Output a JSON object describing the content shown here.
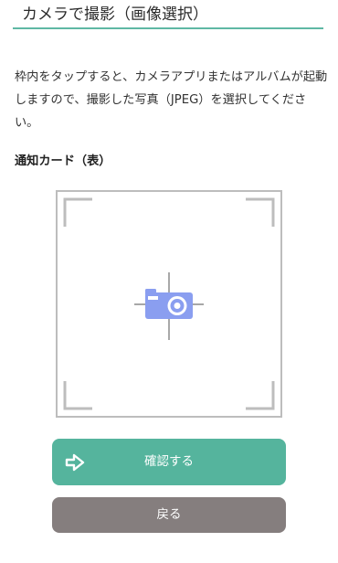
{
  "header": {
    "title": "カメラで撮影（画像選択）",
    "accent_color": "#5fb8a4"
  },
  "instruction": "枠内をタップすると、カメラアプリまたはアルバムが起動しますので、撮影した写真（JPEG）を選択してください。",
  "section_label": "通知カード（表）",
  "capture_frame": {
    "icon": "camera-icon",
    "icon_color": "#8a9ef0"
  },
  "buttons": {
    "confirm_label": "確認する",
    "confirm_icon": "arrow-right-icon",
    "confirm_color": "#55b49d",
    "back_label": "戻る",
    "back_color": "#857e7e"
  }
}
